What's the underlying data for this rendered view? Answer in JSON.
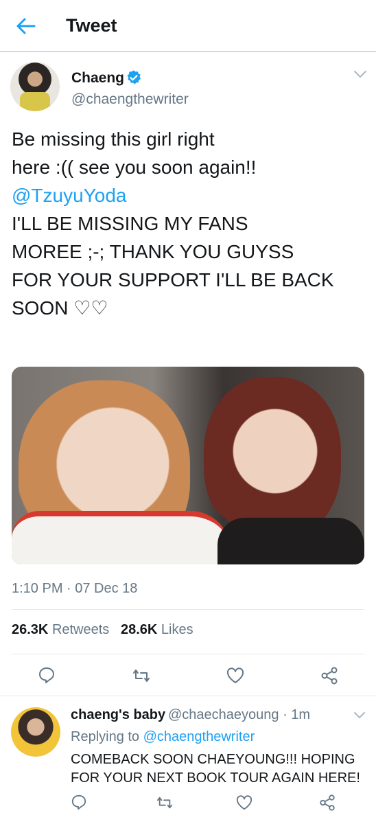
{
  "header": {
    "title": "Tweet"
  },
  "tweet": {
    "author_name": "Chaeng",
    "author_handle": "@chaengthewriter",
    "lines": [
      "Be missing this girl right",
      "here :(( see you soon again!!",
      "@TzuyuYoda",
      "",
      "I'LL BE MISSING MY FANS",
      "MOREE ;-; THANK YOU GUYSS",
      "FOR YOUR SUPPORT I'LL BE BACK",
      "SOON ♡♡"
    ],
    "timestamp": "1:10 PM · 07 Dec 18",
    "retweets_count": "26.3K",
    "retweets_label": "Retweets",
    "likes_count": "28.6K",
    "likes_label": "Likes"
  },
  "reply": {
    "author_name": "chaeng's baby",
    "author_handle_time": "@chaechaeyoung · 1m",
    "replying_prefix": "Replying to ",
    "replying_handle": "@chaengthewriter",
    "lines": [
      "COMEBACK SOON CHAEYOUNG!!! HOPING",
      "FOR YOUR NEXT BOOK TOUR AGAIN HERE!"
    ]
  },
  "icons": [
    "back-arrow-icon",
    "verified-badge-icon",
    "chevron-down-icon",
    "reply-icon",
    "retweet-icon",
    "like-icon",
    "share-icon"
  ],
  "colors": {
    "accent": "#1da1f2",
    "secondary_text": "#657786",
    "primary_text": "#14171a",
    "divider": "#e1e8ed"
  }
}
